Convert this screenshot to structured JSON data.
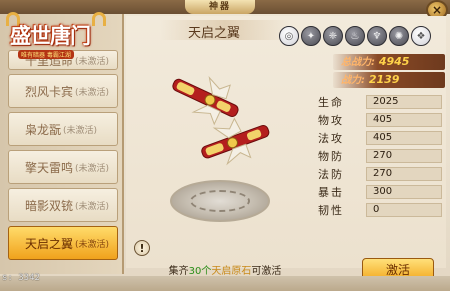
{
  "window": {
    "title": "神器",
    "close_label": "×"
  },
  "logo": {
    "title": "盛世唐门",
    "subtitle": "唯有暗器 毒霸江湖"
  },
  "artifact_list": [
    {
      "name": "千里追命",
      "status": "(未激活)"
    },
    {
      "name": "烈风卡宾",
      "status": "(未激活)"
    },
    {
      "name": "枭龙翫",
      "status": "(未激活)"
    },
    {
      "name": "擎天雷鸣",
      "status": "(未激活)"
    },
    {
      "name": "暗影双铳",
      "status": "(未激活)"
    },
    {
      "name": "天启之翼",
      "status": "(未激活)"
    }
  ],
  "selected": {
    "name": "天启之翼",
    "total_power_label": "总战力:",
    "total_power": "4945",
    "power_label": "战力:",
    "power": "2139"
  },
  "skill_icons": [
    "swirl-icon",
    "claw-icon",
    "dragon-icon",
    "flame-icon",
    "wings-icon",
    "star-burst-icon",
    "mask-icon"
  ],
  "stats": [
    {
      "label": "生命",
      "value": "2025"
    },
    {
      "label": "物攻",
      "value": "405"
    },
    {
      "label": "法攻",
      "value": "405"
    },
    {
      "label": "物防",
      "value": "270"
    },
    {
      "label": "法防",
      "value": "270"
    },
    {
      "label": "暴击",
      "value": "300"
    },
    {
      "label": "韧性",
      "value": "0"
    }
  ],
  "footer": {
    "prefix": "集齐",
    "count": "30个",
    "item": "天启原石",
    "suffix": "可激活",
    "activate_label": "激活",
    "info_label": "!"
  },
  "debug": {
    "fps_text": "s:  3342"
  }
}
